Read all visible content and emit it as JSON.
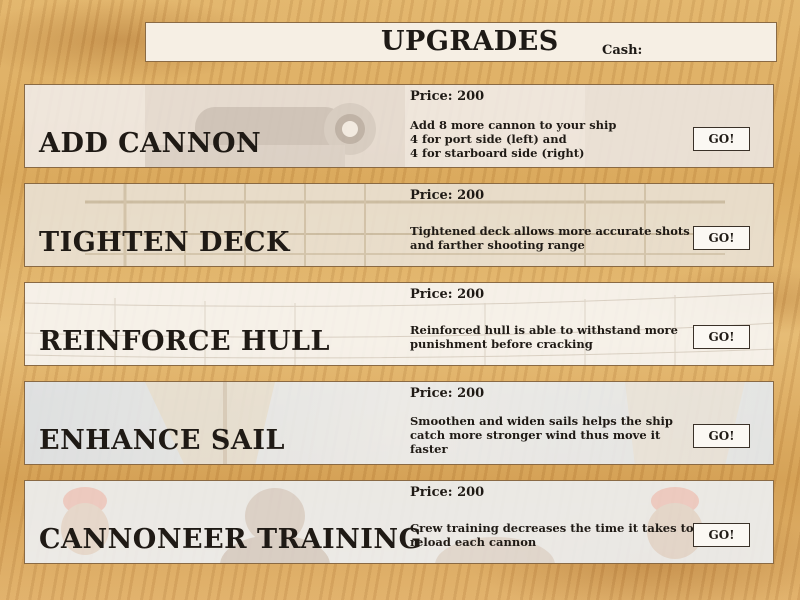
{
  "header": {
    "title": "UPGRADES",
    "cash_label": "Cash:",
    "cash_value": ""
  },
  "upgrades": [
    {
      "name": "ADD CANNON",
      "price": "Price: 200",
      "description": "Add 8 more cannon to your ship\n4 for port side (left) and\n4 for starboard side (right)",
      "button": "GO!"
    },
    {
      "name": "TIGHTEN DECK",
      "price": "Price: 200",
      "description": "Tightened deck allows more accurate shots and farther shooting range",
      "button": "GO!"
    },
    {
      "name": "REINFORCE HULL",
      "price": "Price: 200",
      "description": "Reinforced hull is able to withstand more punishment before cracking",
      "button": "GO!"
    },
    {
      "name": "ENHANCE SAIL",
      "price": "Price: 200",
      "description": "Smoothen and widen sails helps the ship catch more stronger wind thus move it faster",
      "button": "GO!"
    },
    {
      "name": "CANNONEER TRAINING",
      "price": "Price: 200",
      "description": "Crew training decreases the time it takes to reload each cannon",
      "button": "GO!"
    }
  ],
  "colors": {
    "panel_bg": "#f4efe8",
    "text": "#1f1a15",
    "wood": "#dcaa5e"
  }
}
